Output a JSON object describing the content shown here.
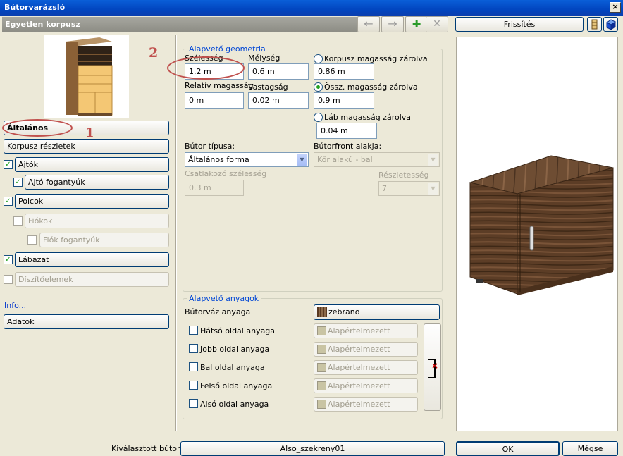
{
  "window": {
    "title": "Bútorvarázsló",
    "close": "×"
  },
  "header": {
    "title": "Egyetlen korpusz"
  },
  "toolbar": {
    "back": "←",
    "forward": "→",
    "add": "✚",
    "delete": "✕"
  },
  "refresh": {
    "label": "Frissítés"
  },
  "sidebar": {
    "general": "Általános",
    "body_details": "Korpusz részletek",
    "doors": "Ajtók",
    "door_handles": "Ajtó fogantyúk",
    "shelves": "Polcok",
    "drawers": "Fiókok",
    "drawer_handles": "Fiók fogantyúk",
    "plinth": "Lábazat",
    "ornaments": "Díszítőelemek",
    "info": "Info...",
    "data": "Adatok"
  },
  "annotations": {
    "one": "1",
    "two": "2"
  },
  "geometry": {
    "title": "Alapvető geometria",
    "width_label": "Szélesség",
    "width_value": "1.2 m",
    "depth_label": "Mélység",
    "depth_value": "0.6 m",
    "rel_height_label": "Relatív magasság",
    "rel_height_value": "0 m",
    "thickness_label": "Vastagság",
    "thickness_value": "0.02 m",
    "lock_body_label": "Korpusz magasság zárolva",
    "lock_body_value": "0.86 m",
    "lock_total_label": "Össz. magasság zárolva",
    "lock_total_value": "0.9 m",
    "lock_leg_label": "Láb magasság zárolva",
    "lock_leg_value": "0.04 m",
    "type_label": "Bútor típusa:",
    "type_value": "Általános forma",
    "front_label": "Bútorfront alakja:",
    "front_value": "Kör alakú - bal",
    "joint_label": "Csatlakozó szélesség",
    "joint_value": "0.3 m",
    "detail_label": "Részletesség",
    "detail_value": "7"
  },
  "materials": {
    "title": "Alapvető anyagok",
    "frame_label": "Bútorváz anyaga",
    "frame_value": "zebrano",
    "back_label": "Hátsó oldal anyaga",
    "right_label": "Jobb oldal anyaga",
    "left_label": "Bal oldal anyaga",
    "top_label": "Felső oldal anyaga",
    "bottom_label": "Alsó oldal anyaga",
    "default_value": "Alapértelmezett",
    "clear": "×"
  },
  "footer": {
    "selected_label": "Kiválasztott bútor:",
    "selected_value": "Also_szekreny01",
    "ok": "OK",
    "cancel": "Mégse"
  }
}
